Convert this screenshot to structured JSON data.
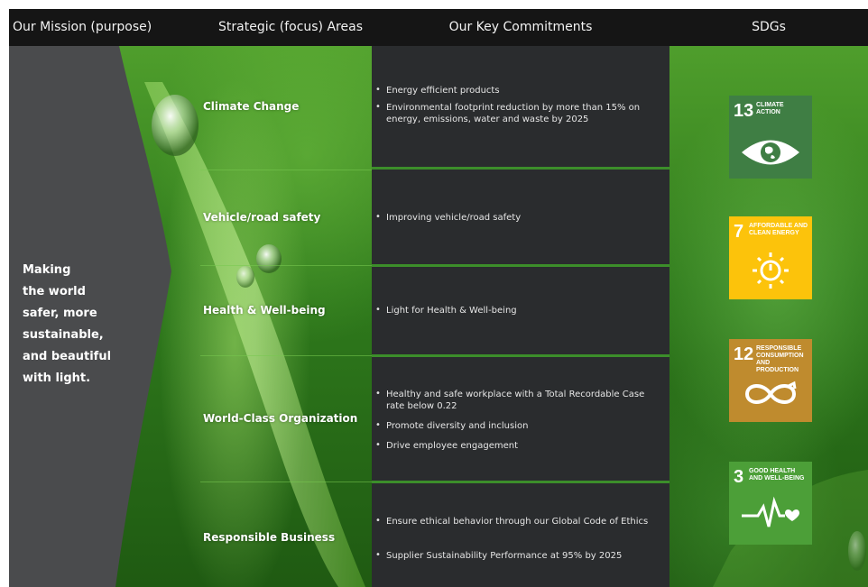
{
  "header": {
    "mission": "Our Mission (purpose)",
    "areas": "Strategic (focus) Areas",
    "commitments": "Our Key Commitments",
    "sdgs": "SDGs"
  },
  "mission": {
    "lines": [
      "Making",
      "the world",
      "safer, more",
      "sustainable,",
      "and beautiful",
      "with light."
    ]
  },
  "areas": [
    {
      "label": "Climate Change",
      "commitments": [
        "Energy efficient products",
        "Environmental footprint reduction by more than 15% on energy, emissions, water and waste by 2025"
      ]
    },
    {
      "label": "Vehicle/road safety",
      "commitments": [
        "Improving vehicle/road safety"
      ]
    },
    {
      "label": "Health & Well-being",
      "commitments": [
        "Light for Health & Well-being"
      ]
    },
    {
      "label": "World-Class Organization",
      "commitments": [
        "Healthy and safe workplace with a Total Recordable Case rate below 0.22",
        "Promote diversity and inclusion",
        "Drive employee engagement"
      ]
    },
    {
      "label": "Responsible Business",
      "commitments": [
        "Ensure ethical behavior through our Global Code of Ethics",
        "Supplier Sustainability Performance at 95% by 2025"
      ]
    }
  ],
  "sdgs": [
    {
      "number": "13",
      "title": "CLIMATE ACTION",
      "color": "#3f7e44",
      "icon": "eye-earth-icon"
    },
    {
      "number": "7",
      "title": "AFFORDABLE AND CLEAN ENERGY",
      "color": "#fcc30b",
      "icon": "sun-power-icon"
    },
    {
      "number": "12",
      "title": "RESPONSIBLE CONSUMPTION AND PRODUCTION",
      "color": "#bf8b2e",
      "icon": "infinity-icon"
    },
    {
      "number": "3",
      "title": "GOOD HEALTH AND WELL-BEING",
      "color": "#4c9f38",
      "icon": "heartbeat-icon"
    }
  ],
  "colors": {
    "header_bg": "#151515",
    "mission_panel": "#4a4b4d",
    "commit_bg": "#2a2c2e",
    "divider_green": "#3c8e2a"
  }
}
